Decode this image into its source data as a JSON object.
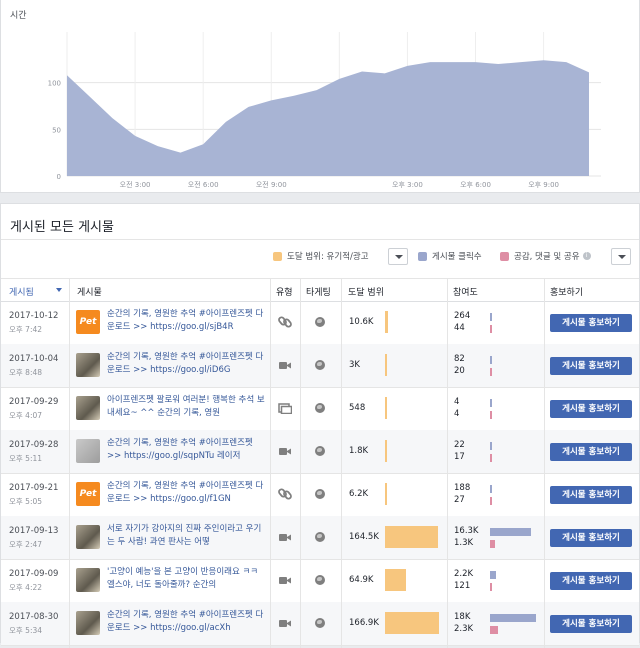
{
  "chart": {
    "title": "시간",
    "chart_data": {
      "type": "area",
      "y_ticks": [
        "0",
        "50",
        "100"
      ],
      "ylim": [
        0,
        150
      ],
      "x_labels": [
        "오전 3:00",
        "오전 6:00",
        "오전 9:00",
        "오후 3:00",
        "오후 6:00",
        "오후 9:00"
      ],
      "x_label_hours": [
        3,
        6,
        9,
        15,
        18,
        21
      ],
      "series_hours": [
        0,
        1,
        2,
        3,
        4,
        5,
        6,
        7,
        8,
        9,
        10,
        11,
        12,
        13,
        14,
        15,
        16,
        17,
        18,
        19,
        20,
        21,
        22,
        23
      ],
      "values": [
        108,
        85,
        62,
        43,
        32,
        25,
        34,
        58,
        74,
        81,
        86,
        92,
        104,
        112,
        110,
        118,
        122,
        122,
        122,
        120,
        122,
        124,
        122,
        111
      ],
      "color": "#a8b4d4",
      "grid": true
    }
  },
  "posts": {
    "title": "게시된 모든 게시물",
    "legend": {
      "reach_label": "도달 범위: 유기적/광고",
      "clicks_label": "게시물 클릭수",
      "reactions_label": "공감, 댓글 및 공유",
      "reach_color": "#f7c67e",
      "clicks_color": "#9aa6cc",
      "reactions_color": "#de8ea4"
    },
    "columns": {
      "published": "게시됨",
      "post": "게시물",
      "type": "유형",
      "targeting": "타게팅",
      "reach": "도달 범위",
      "engagement": "참여도",
      "promote": "홍보하기"
    },
    "rows": [
      {
        "date": "2017-10-12",
        "time": "오후 7:42",
        "text": "순간의 기록, 영원한 추억 #아이프렌즈펫 다운로드 >> https://goo.gl/sjB4R",
        "type_icon": "link-icon",
        "thumb": "pet-logo",
        "reach": "10.6K",
        "reach_frac": 0.06,
        "clicks": "264",
        "reactions": "44",
        "clicks_frac": 0.0,
        "reactions_frac": 0.0,
        "button": "게시물 홍보하기"
      },
      {
        "date": "2017-10-04",
        "time": "오후 8:48",
        "text": "순간의 기록, 영원한 추억 #아이프렌즈펫 다운로드 >> https://goo.gl/iD6G",
        "type_icon": "video-icon",
        "thumb": "photo",
        "reach": "3K",
        "reach_frac": 0.0,
        "clicks": "82",
        "reactions": "20",
        "clicks_frac": 0.0,
        "reactions_frac": 0.0,
        "button": "게시물 홍보하기"
      },
      {
        "date": "2017-09-29",
        "time": "오후 4:07",
        "text": "아이프렌즈펫 팔로워 여러분! 행복한 추석 보내세요~ ^^ 순간의 기록, 영원",
        "type_icon": "album-icon",
        "thumb": "photo",
        "reach": "548",
        "reach_frac": 0.0,
        "clicks": "4",
        "reactions": "4",
        "clicks_frac": 0.0,
        "reactions_frac": 0.0,
        "button": "게시물 홍보하기"
      },
      {
        "date": "2017-09-28",
        "time": "오후 5:11",
        "text": "순간의 기록, 영원한 추억 #아이프렌즈펫 >> https://goo.gl/sqpNTu 레이저",
        "type_icon": "video-icon",
        "thumb": "photo-gray",
        "reach": "1.8K",
        "reach_frac": 0.0,
        "clicks": "22",
        "reactions": "17",
        "clicks_frac": 0.0,
        "reactions_frac": 0.0,
        "button": "게시물 홍보하기"
      },
      {
        "date": "2017-09-21",
        "time": "오후 5:05",
        "text": "순간의 기록, 영원한 추억 #아이프렌즈펫 다운로드 >> https://goo.gl/f1GN",
        "type_icon": "link-icon",
        "thumb": "pet-logo",
        "reach": "6.2K",
        "reach_frac": 0.03,
        "clicks": "188",
        "reactions": "27",
        "clicks_frac": 0.0,
        "reactions_frac": 0.0,
        "button": "게시물 홍보하기"
      },
      {
        "date": "2017-09-13",
        "time": "오후 2:47",
        "text": "서로 자기가 강아지의 진짜 주인이라고 우기는 두 사람! 과연 판사는 어떻",
        "type_icon": "video-icon",
        "thumb": "photo",
        "reach": "164.5K",
        "reach_frac": 0.98,
        "clicks": "16.3K",
        "reactions": "1.3K",
        "clicks_frac": 0.9,
        "reactions_frac": 0.07,
        "button": "게시물 홍보하기"
      },
      {
        "date": "2017-09-09",
        "time": "오후 4:22",
        "text": "'고양이 예능'을 본 고양이 반응이래요 ㅋㅋ 엘스야, 너도 돌아줄까? 순간의",
        "type_icon": "video-icon",
        "thumb": "photo",
        "reach": "64.9K",
        "reach_frac": 0.39,
        "clicks": "2.2K",
        "reactions": "121",
        "clicks_frac": 0.12,
        "reactions_frac": 0.0,
        "button": "게시물 홍보하기"
      },
      {
        "date": "2017-08-30",
        "time": "오후 5:34",
        "text": "순간의 기록, 영원한 추억 #아이프렌즈펫 다운로드 >> https://goo.gl/acXh",
        "type_icon": "video-icon",
        "thumb": "photo",
        "reach": "166.9K",
        "reach_frac": 1.0,
        "clicks": "18K",
        "reactions": "2.3K",
        "clicks_frac": 1.0,
        "reactions_frac": 0.13,
        "button": "게시물 홍보하기"
      }
    ]
  }
}
